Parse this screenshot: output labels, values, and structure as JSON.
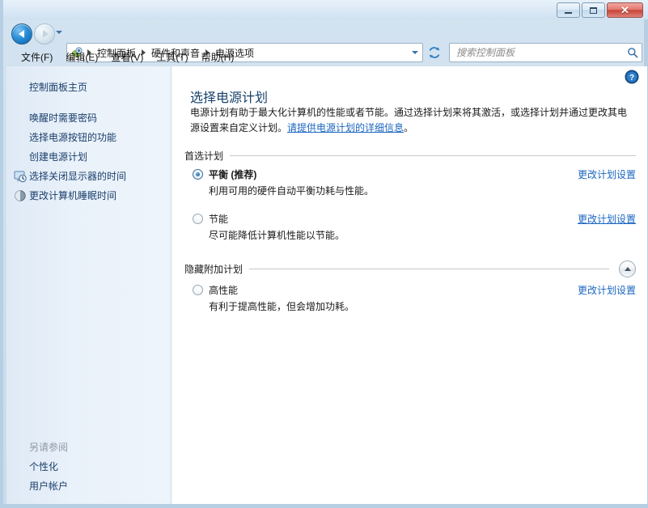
{
  "window": {
    "titlebar_buttons": {
      "minimize": "最小化",
      "maximize": "最大化",
      "close": "关闭",
      "close_glyph": "✕"
    }
  },
  "nav": {
    "back_tooltip": "后退",
    "forward_tooltip": "前进",
    "history_tooltip": "最近访问的位置",
    "refresh_tooltip": "刷新",
    "breadcrumbs": [
      "控制面板",
      "硬件和声音",
      "电源选项"
    ]
  },
  "search": {
    "placeholder": "搜索控制面板",
    "value": "",
    "icon": "search-icon"
  },
  "menubar": {
    "items": [
      {
        "label": "文件(F)"
      },
      {
        "label": "编辑(E)"
      },
      {
        "label": "查看(V)"
      },
      {
        "label": "工具(T)"
      },
      {
        "label": "帮助(H)"
      }
    ]
  },
  "sidebar": {
    "home_label": "控制面板主页",
    "items": [
      {
        "label": "唤醒时需要密码",
        "icon": null
      },
      {
        "label": "选择电源按钮的功能",
        "icon": null
      },
      {
        "label": "创建电源计划",
        "icon": null
      },
      {
        "label": "选择关闭显示器的时间",
        "icon": "clock-monitor-icon"
      },
      {
        "label": "更改计算机睡眠时间",
        "icon": "moon-sleep-icon"
      }
    ],
    "see_also": {
      "title": "另请参阅",
      "items": [
        {
          "label": "个性化"
        },
        {
          "label": "用户帐户"
        }
      ]
    }
  },
  "main": {
    "help_icon": "help-icon",
    "title": "选择电源计划",
    "description_part1": "电源计划有助于最大化计算机的性能或者节能。通过选择计划来将其激活，或选择计划并通过更改其电源设置来自定义计划。",
    "description_link": "请提供电源计划的详细信息",
    "description_part2": "。",
    "sections": [
      {
        "label": "首选计划",
        "collapsible": false,
        "plans": [
          {
            "name": "平衡 (推荐)",
            "selected": true,
            "bold": true,
            "description": "利用可用的硬件自动平衡功耗与性能。",
            "link_label": "更改计划设置",
            "link_hovered": false
          },
          {
            "name": "节能",
            "selected": false,
            "bold": false,
            "description": "尽可能降低计算机性能以节能。",
            "link_label": "更改计划设置",
            "link_hovered": true
          }
        ]
      },
      {
        "label": "隐藏附加计划",
        "collapsible": true,
        "collapse_icon": "chevron-up-icon",
        "plans": [
          {
            "name": "高性能",
            "selected": false,
            "bold": false,
            "description": "有利于提高性能，但会增加功耗。",
            "link_label": "更改计划设置",
            "link_hovered": false
          }
        ]
      }
    ]
  },
  "colors": {
    "accent_link": "#1a66c0",
    "title_blue": "#17426b",
    "sidebar_bg": "#e9f1fa",
    "frame_blue": "#b6cfe3"
  }
}
